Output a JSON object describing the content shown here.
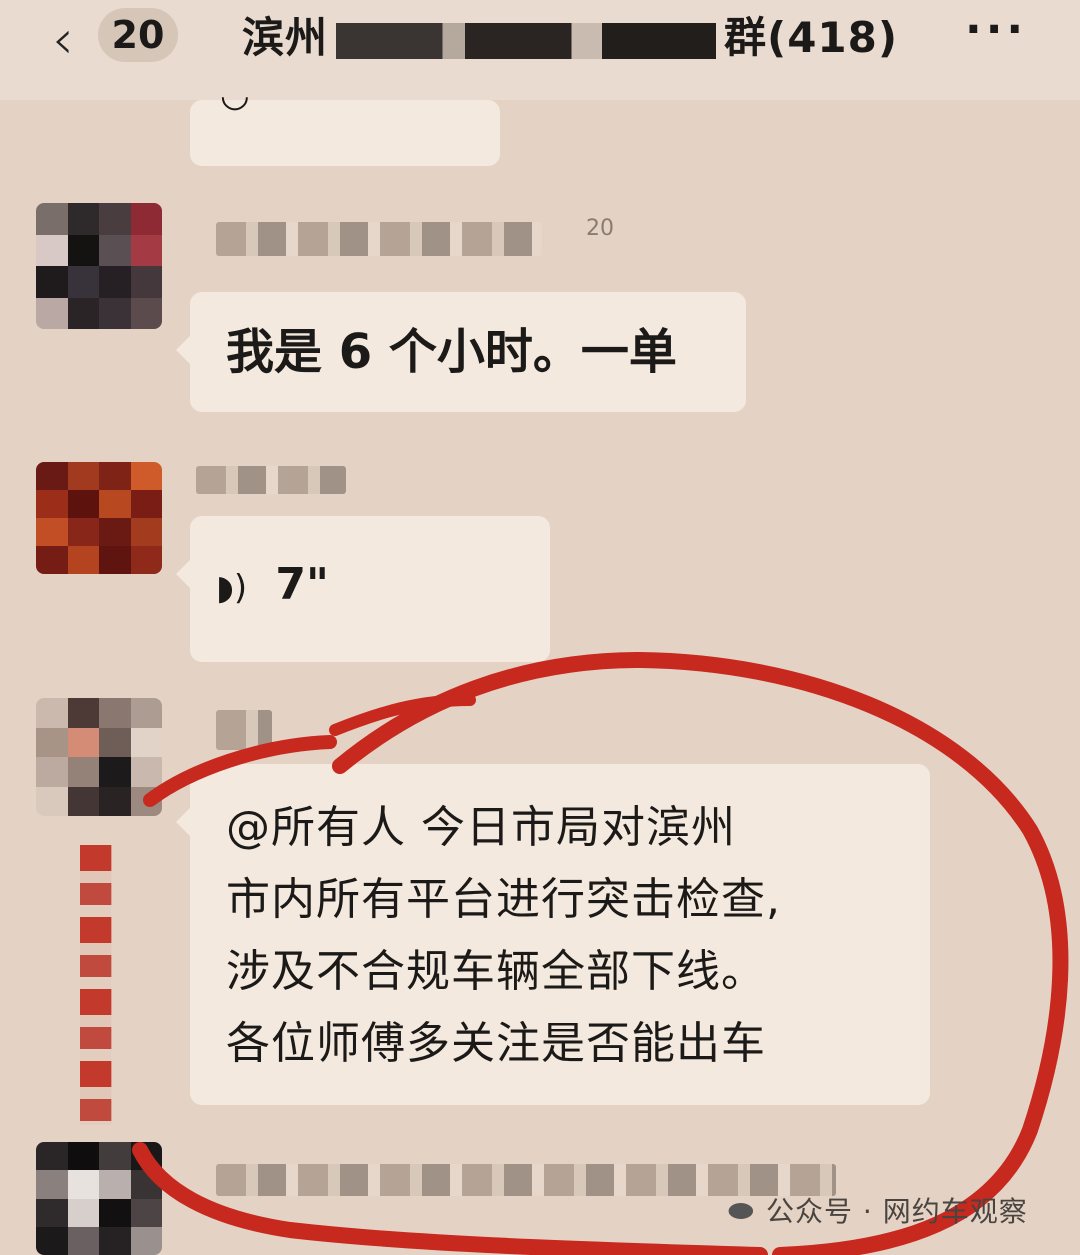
{
  "header": {
    "back_icon": "chevron-left-icon",
    "unread_count": "20",
    "title_prefix": "滨州",
    "title_suffix": "群(418)",
    "more_icon": "ellipsis-icon"
  },
  "messages": [
    {
      "type": "voice",
      "duration": ""
    },
    {
      "type": "text",
      "sender_tail": "20",
      "text": "我是 6 个小时。一单"
    },
    {
      "type": "voice",
      "duration": "7\""
    },
    {
      "type": "text",
      "lines": [
        "@所有人    今日市局对滨州",
        "市内所有平台进行突击检查,",
        "涉及不合规车辆全部下线。",
        "各位师傅多关注是否能出车"
      ]
    }
  ],
  "watermark": {
    "icon": "wechat-icon",
    "text": "公众号 · 网约车观察"
  },
  "colors": {
    "background": "#e4d3c5",
    "bubble": "#f4e9de",
    "annotation_red": "#c7291e"
  }
}
